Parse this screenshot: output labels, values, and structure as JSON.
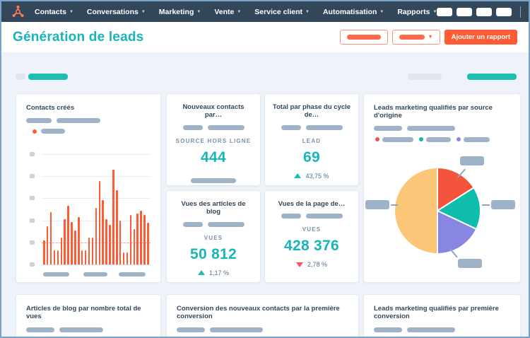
{
  "nav": {
    "items": [
      {
        "id": "contacts",
        "label": "Contacts"
      },
      {
        "id": "conversations",
        "label": "Conversations"
      },
      {
        "id": "marketing",
        "label": "Marketing"
      },
      {
        "id": "vente",
        "label": "Vente"
      },
      {
        "id": "service-client",
        "label": "Service client"
      },
      {
        "id": "automatisation",
        "label": "Automatisation"
      },
      {
        "id": "rapports",
        "label": "Rapports"
      }
    ],
    "logo": "hubspot-sprocket",
    "right_icon_placeholders": 4,
    "avatar": "user-photo-on-orange-circle"
  },
  "header": {
    "title": "Génération de leads",
    "add_report_label": "Ajouter un rapport",
    "filter_buttons": "2 outlined orange placeholder buttons, second with dropdown caret"
  },
  "cards": {
    "contacts_created": {
      "title": "Contacts créés"
    },
    "new_contacts": {
      "title": "Nouveaux contacts par…",
      "metric_label": "SOURCE HORS LIGNE",
      "value": "444"
    },
    "lifecycle": {
      "title": "Total par phase du cycle de…",
      "metric_label": "LEAD",
      "value": "69",
      "delta": "43,75 %",
      "delta_dir": "up"
    },
    "blog_views": {
      "title": "Vues des articles de blog",
      "metric_label": "VUES",
      "value": "50 812",
      "delta": "1,17 %",
      "delta_dir": "up"
    },
    "page_views": {
      "title": "Vues de la page de…",
      "metric_label": "VUES",
      "value": "428 376",
      "delta": "2,78 %",
      "delta_dir": "down"
    },
    "mql_source": {
      "title": "Leads marketing qualifiés par source d'origine"
    },
    "blog_total": {
      "title": "Articles de blog par nombre total de vues"
    },
    "conversion": {
      "title": "Conversion des nouveaux contacts par la première conversion"
    },
    "mql_conversion": {
      "title": "Leads marketing qualifiés par première conversion"
    }
  },
  "chart_data": [
    {
      "type": "bar",
      "title": "Contacts créés",
      "values": [
        25,
        40,
        55,
        15,
        15,
        28,
        48,
        62,
        45,
        36,
        50,
        15,
        15,
        28,
        28,
        60,
        88,
        68,
        48,
        42,
        100,
        78,
        46,
        13,
        13,
        52,
        37,
        54,
        57,
        52,
        44
      ],
      "value_scale": "relative 0-100, axis tick labels are gray placeholders",
      "color": "#ff5c35",
      "grid": true,
      "y_ticks": "6 placeholder squares",
      "x_labels": "3 placeholder pills",
      "target_line": {
        "style": "dashed",
        "color": "#ff8d6b",
        "level_pct_from_bottom": 20
      }
    },
    {
      "type": "pie",
      "title": "Leads marketing qualifiés par source d'origine",
      "slices": [
        {
          "name": "slice-red",
          "value": 16,
          "color": "#f4543c"
        },
        {
          "name": "slice-teal",
          "value": 16,
          "color": "#0fbdad"
        },
        {
          "name": "slice-purple",
          "value": 18,
          "color": "#8885e3"
        },
        {
          "name": "slice-peach",
          "value": 50,
          "color": "#fcc678"
        }
      ],
      "legend_items": [
        {
          "color": "#f4543c",
          "placeholder_width": 44
        },
        {
          "color": "#0fbdad",
          "placeholder_width": 35
        },
        {
          "color": "#8885e3",
          "placeholder_width": 37
        }
      ],
      "callouts": "4 gray placeholder labels with leader lines (top, right, bottom, left)"
    }
  ],
  "colors": {
    "nav_bg": "#33475b",
    "brand_orange": "#ff5c35",
    "logo_orange": "#ff7a59",
    "teal_text": "#17b5ba",
    "teal_accent": "#1fbdb4",
    "red": "#f2545b",
    "bar_color": "#ff5c35",
    "placeholder": "#9fb3c8",
    "border_blue": "#7aa1c6"
  }
}
